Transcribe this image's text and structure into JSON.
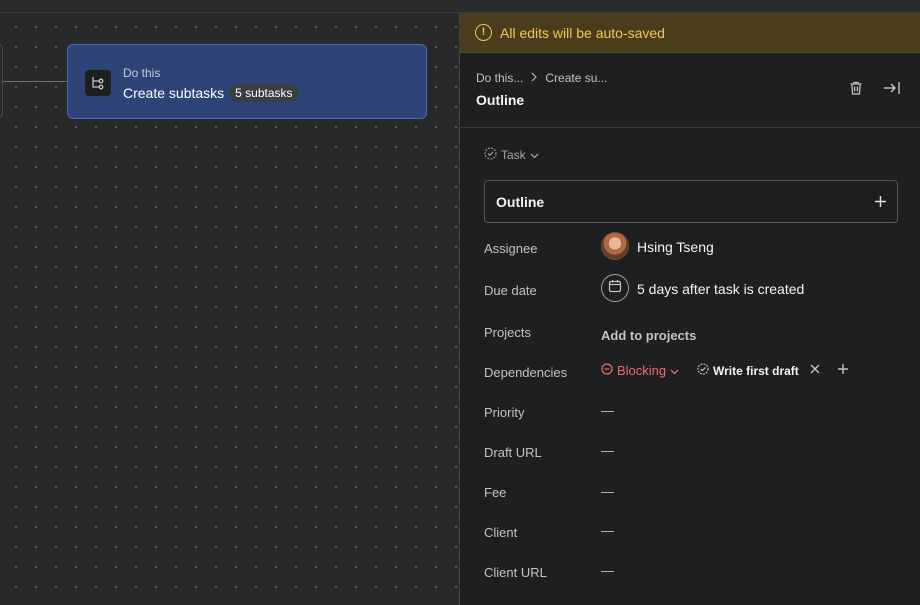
{
  "canvas": {
    "rule_node": {
      "kicker": "Do this",
      "title": "Create subtasks",
      "badge": "5 subtasks"
    }
  },
  "panel": {
    "banner": "All edits will be auto-saved",
    "breadcrumb": [
      "Do this...",
      "Create su..."
    ],
    "title": "Outline",
    "type_label": "Task",
    "task_name": "Outline",
    "fields": {
      "assignee": {
        "label": "Assignee",
        "value": "Hsing Tseng"
      },
      "due_date": {
        "label": "Due date",
        "value": "5 days after task is created"
      },
      "projects": {
        "label": "Projects",
        "value": "Add to projects"
      },
      "dependencies": {
        "label": "Dependencies",
        "type": "Blocking",
        "task": "Write first draft"
      },
      "priority": {
        "label": "Priority",
        "value": "—"
      },
      "draft_url": {
        "label": "Draft URL",
        "value": "—"
      },
      "fee": {
        "label": "Fee",
        "value": "—"
      },
      "client": {
        "label": "Client",
        "value": "—"
      },
      "client_url": {
        "label": "Client URL",
        "value": "—"
      }
    }
  },
  "colors": {
    "banner_bg": "#4a3d1c",
    "banner_text": "#f3c55a",
    "node_bg": "#2e4478",
    "blocking": "#f06a6a",
    "panel_bg": "#1e1f21"
  },
  "icons": {
    "banner": "warning-icon",
    "rule": "subtasks-icon",
    "delete": "trash-icon",
    "close": "collapse-panel-icon",
    "type": "check-circle-icon",
    "due": "calendar-icon"
  }
}
